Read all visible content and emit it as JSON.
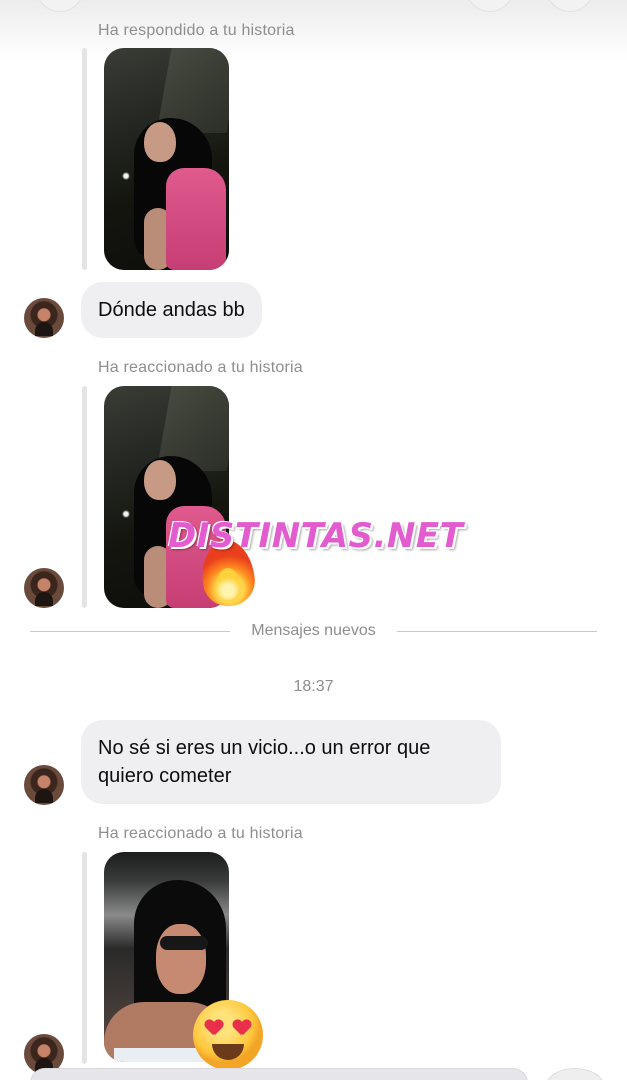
{
  "conversation": {
    "story_reply_label": "Ha respondido a tu historia",
    "story_reaction_label_1": "Ha reaccionado a tu historia",
    "story_reaction_label_2": "Ha reaccionado a tu historia",
    "messages": [
      {
        "text": "Dónde andas bb"
      },
      {
        "text": "No sé si eres un vicio...o un error que quiero cometer"
      }
    ],
    "new_messages_divider": "Mensajes nuevos",
    "timestamp": "18:37",
    "reactions": [
      "fire-emoji",
      "heart-eyes-emoji"
    ]
  },
  "overlay": {
    "watermark": "DISTINTAS.NET"
  },
  "colors": {
    "bubble": "#efeff1",
    "meta_text": "#8e8e8e",
    "watermark": "#e25cd0"
  }
}
